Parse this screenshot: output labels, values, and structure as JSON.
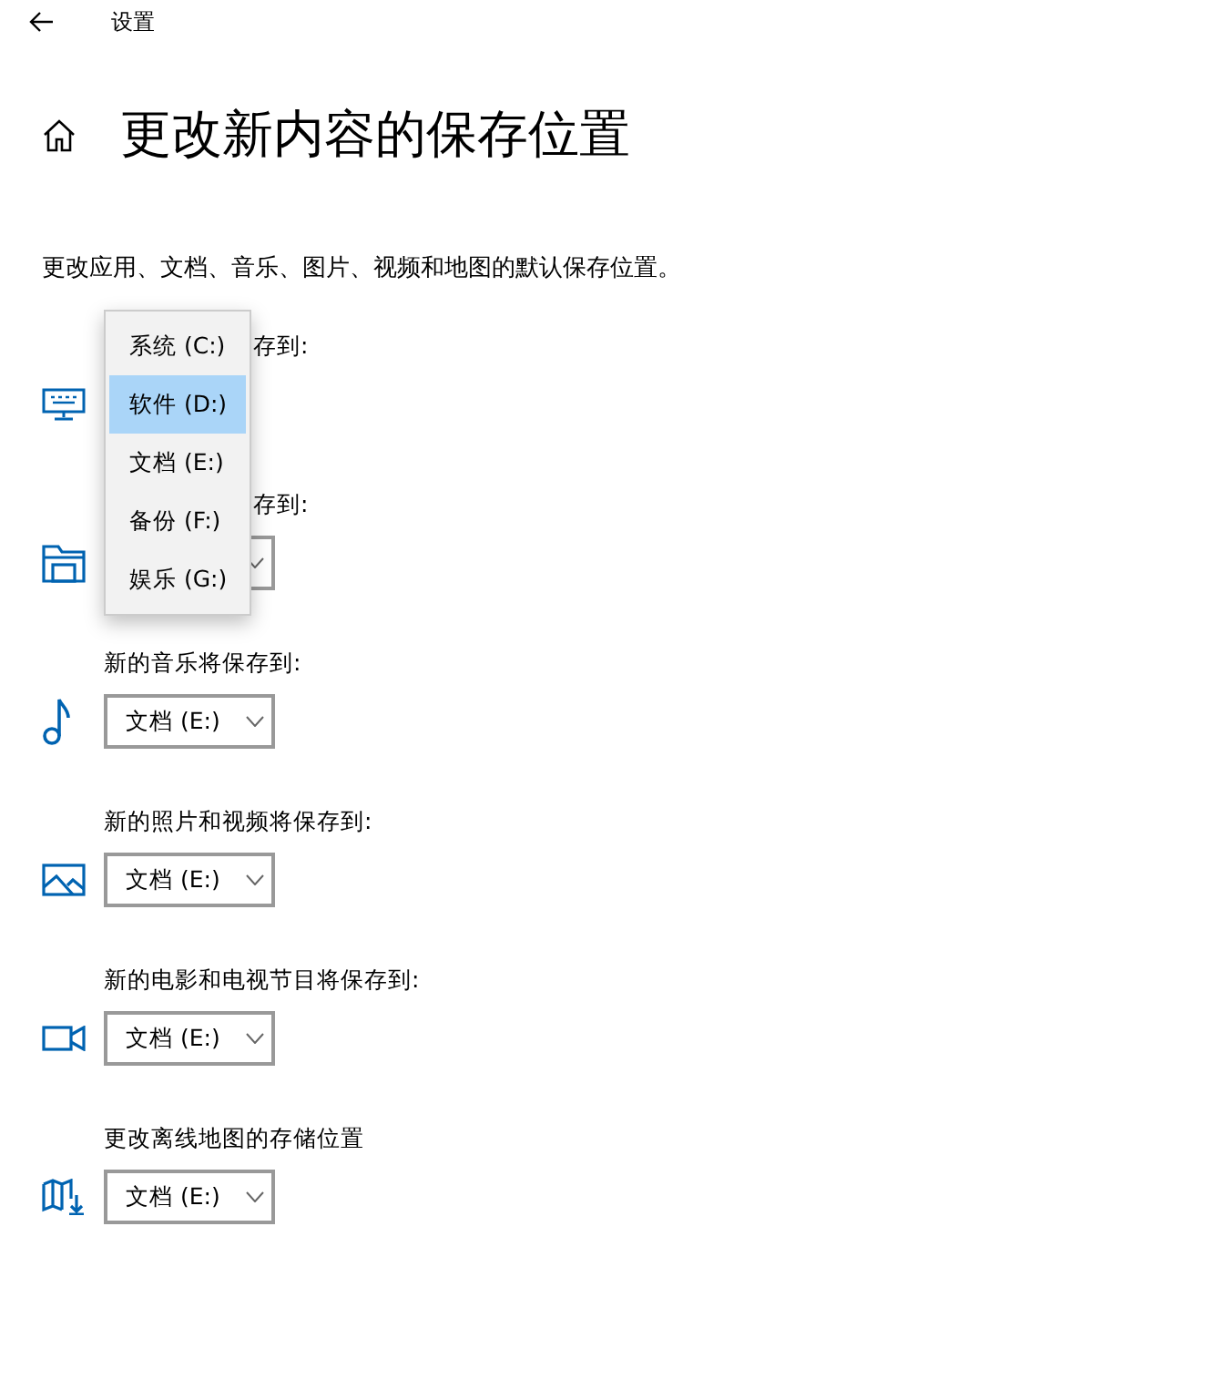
{
  "header": {
    "title": "设置"
  },
  "page": {
    "title": "更改新内容的保存位置",
    "description": "更改应用、文档、音乐、图片、视频和地图的默认保存位置。"
  },
  "locations": [
    {
      "kind": "apps",
      "label": "存到:",
      "expanded": true
    },
    {
      "kind": "documents",
      "label": "存到:",
      "expanded": false
    },
    {
      "kind": "music",
      "label": "新的音乐将保存到:",
      "value": "文档 (E:)",
      "expanded": false
    },
    {
      "kind": "photos",
      "label": "新的照片和视频将保存到:",
      "value": "文档 (E:)",
      "expanded": false
    },
    {
      "kind": "movies",
      "label": "新的电影和电视节目将保存到:",
      "value": "文档 (E:)",
      "expanded": false
    },
    {
      "kind": "maps",
      "label": "更改离线地图的存储位置",
      "value": "文档 (E:)",
      "expanded": false
    }
  ],
  "drive_menu": [
    {
      "label": "系统 (C:)",
      "selected": false
    },
    {
      "label": "软件 (D:)",
      "selected": true
    },
    {
      "label": "文档 (E:)",
      "selected": false
    },
    {
      "label": "备份 (F:)",
      "selected": false
    },
    {
      "label": "娱乐 (G:)",
      "selected": false
    }
  ]
}
